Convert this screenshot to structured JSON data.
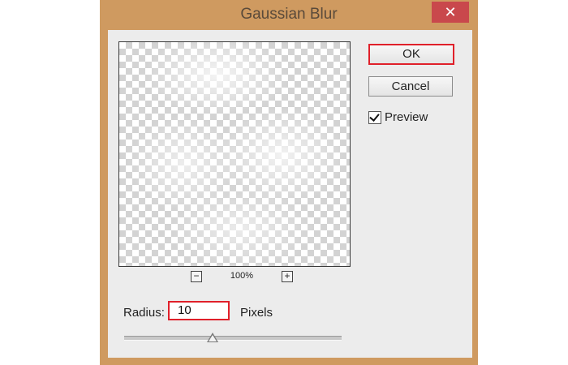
{
  "dialog": {
    "title": "Gaussian Blur",
    "close_label": "✕"
  },
  "buttons": {
    "ok_label": "OK",
    "cancel_label": "Cancel"
  },
  "preview_option": {
    "label": "Preview",
    "checked": true
  },
  "zoom": {
    "out_symbol": "−",
    "level": "100%",
    "in_symbol": "+"
  },
  "radius": {
    "label": "Radius:",
    "value": "10",
    "unit": "Pixels"
  },
  "colors": {
    "window_frame": "#cf9a60",
    "client_background": "#ececec",
    "highlight_red": "#e0202a",
    "close_button": "#c9484c"
  }
}
